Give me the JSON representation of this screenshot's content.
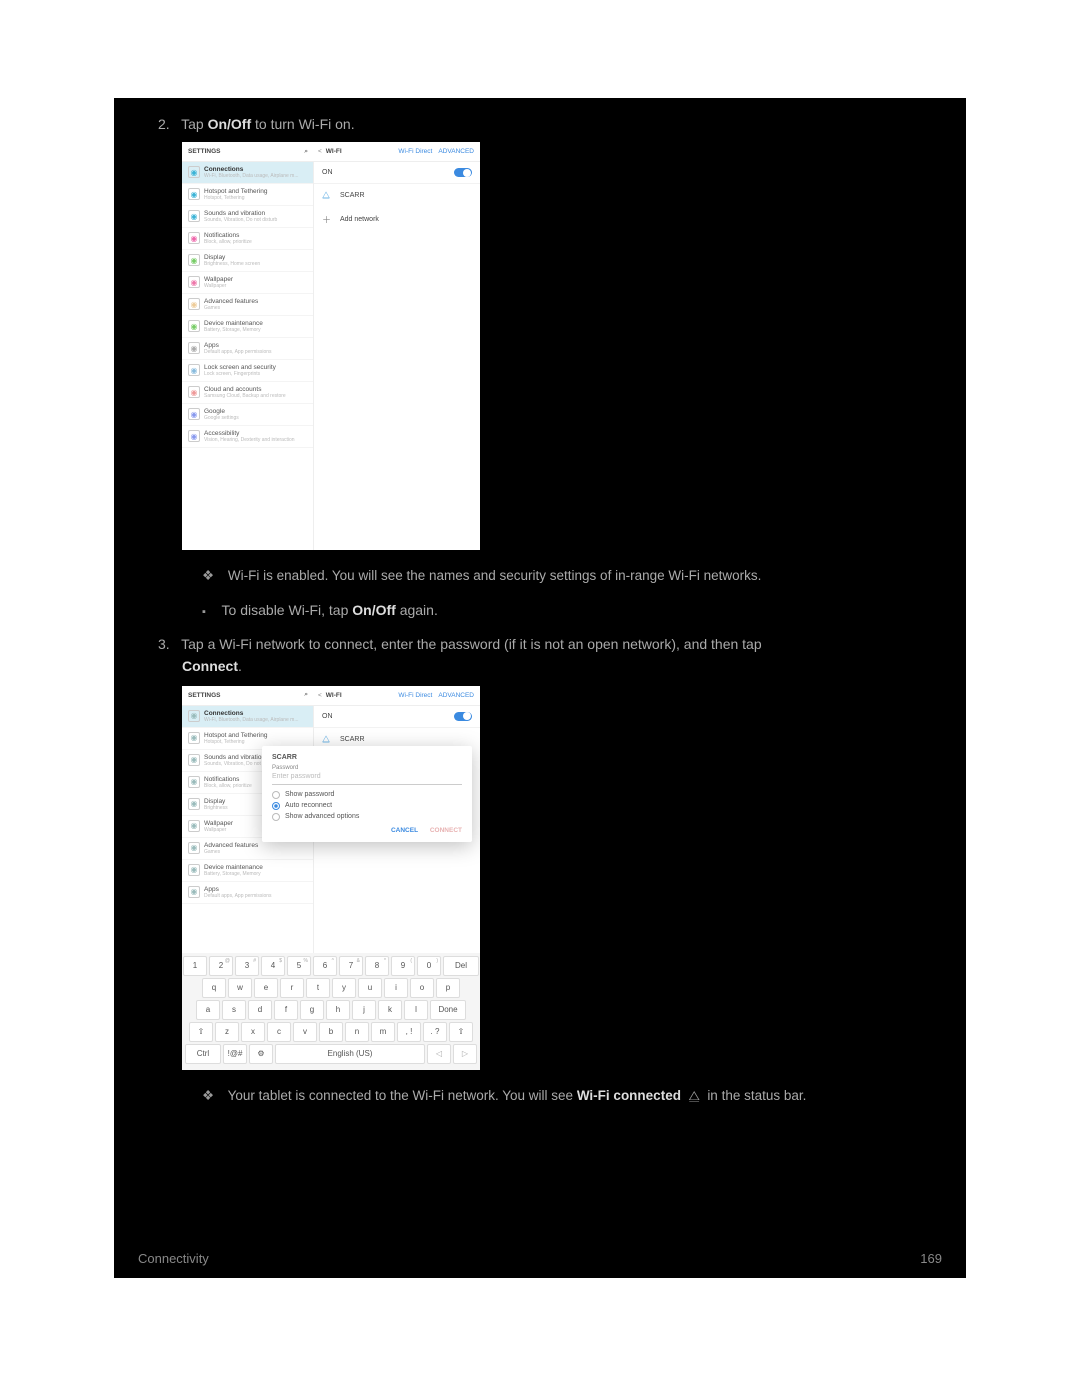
{
  "step2_prefix": "2.",
  "step2_text_a": "Tap ",
  "step2_bold": "On/Off",
  "step2_text_b": " to turn Wi-Fi on.",
  "screenshot1": {
    "header_left": "SETTINGS",
    "header_right_title": "WI-FI",
    "header_link_direct": "Wi-Fi Direct",
    "header_link_advanced": "ADVANCED",
    "on_label": "ON",
    "network_name": "SCARR",
    "add_network": "Add network",
    "items": [
      {
        "title": "Connections",
        "sub": "Wi-Fi, Bluetooth, Data usage, Airplane m...",
        "sel": true,
        "color": "#3bb3d6"
      },
      {
        "title": "Hotspot and Tethering",
        "sub": "Hotspot, Tethering",
        "color": "#3bb3d6"
      },
      {
        "title": "Sounds and vibration",
        "sub": "Sounds, Vibration, Do not disturb",
        "color": "#3bb3d6"
      },
      {
        "title": "Notifications",
        "sub": "Block, allow, prioritize",
        "color": "#e6a"
      },
      {
        "title": "Display",
        "sub": "Brightness, Home screen",
        "color": "#7c6"
      },
      {
        "title": "Wallpaper",
        "sub": "Wallpaper",
        "color": "#e7a"
      },
      {
        "title": "Advanced features",
        "sub": "Games",
        "color": "#ec9"
      },
      {
        "title": "Device maintenance",
        "sub": "Battery, Storage, Memory",
        "color": "#7c6"
      },
      {
        "title": "Apps",
        "sub": "Default apps, App permissions",
        "color": "#aaa"
      },
      {
        "title": "Lock screen and security",
        "sub": "Lock screen, Fingerprints",
        "color": "#8bd"
      },
      {
        "title": "Cloud and accounts",
        "sub": "Samsung Cloud, Backup and restore",
        "color": "#e99"
      },
      {
        "title": "Google",
        "sub": "Google settings",
        "color": "#89e"
      },
      {
        "title": "Accessibility",
        "sub": "Vision, Hearing, Dexterity and interaction",
        "color": "#89e"
      }
    ]
  },
  "bullet1": "Wi-Fi is enabled. You will see the names and security settings of in-range Wi-Fi networks.",
  "bullet2_a": "To disable Wi-Fi, tap ",
  "bullet2_bold": "On/Off",
  "bullet2_b": " again.",
  "step3_prefix": "3.",
  "step3_a": "Tap a Wi-Fi network to connect, enter the password (if it is not an open network), and then tap ",
  "step3_bold": "Connect",
  "step3_b": ".",
  "screenshot2": {
    "header_left": "SETTINGS",
    "header_right_title": "WI-FI",
    "header_link_direct": "Wi-Fi Direct",
    "header_link_advanced": "ADVANCED",
    "on_label": "ON",
    "network_name": "SCARR",
    "dialog": {
      "title": "SCARR",
      "pw_label": "Password",
      "pw_placeholder": "Enter password",
      "opt1": "Show password",
      "opt2": "Auto reconnect",
      "opt3": "Show advanced options",
      "cancel": "CANCEL",
      "connect": "CONNECT"
    },
    "left_items": [
      {
        "title": "Connections",
        "sub": "Wi-Fi, Bluetooth, Data usage, Airplane m...",
        "sel": true
      },
      {
        "title": "Hotspot and Tethering",
        "sub": "Hotspot, Tethering"
      },
      {
        "title": "Sounds and vibration",
        "sub": "Sounds, Vibration, Do not disturb"
      },
      {
        "title": "Notifications",
        "sub": "Block, allow, prioritize"
      },
      {
        "title": "Display",
        "sub": "Brightness"
      },
      {
        "title": "Wallpaper",
        "sub": "Wallpaper"
      },
      {
        "title": "Advanced features",
        "sub": "Games"
      },
      {
        "title": "Device maintenance",
        "sub": "Battery, Storage, Memory"
      },
      {
        "title": "Apps",
        "sub": "Default apps, App permissions"
      }
    ],
    "keyboard": {
      "row1": [
        "1",
        "2",
        "3",
        "4",
        "5",
        "6",
        "7",
        "8",
        "9",
        "0",
        "Del"
      ],
      "row1_sup": [
        "",
        "@",
        "#",
        "$",
        "%",
        "^",
        "&",
        "*",
        "(",
        ")",
        ""
      ],
      "row2": [
        "q",
        "w",
        "e",
        "r",
        "t",
        "y",
        "u",
        "i",
        "o",
        "p"
      ],
      "row3": [
        "a",
        "s",
        "d",
        "f",
        "g",
        "h",
        "j",
        "k",
        "l",
        "Done"
      ],
      "row4": [
        "⇧",
        "z",
        "x",
        "c",
        "v",
        "b",
        "n",
        "m",
        ", !",
        ". ?",
        "⇧"
      ],
      "row5_ctrl": "Ctrl",
      "row5_sym": "!@#",
      "row5_gear": "⚙",
      "row5_space": "English (US)",
      "row5_left": "◁",
      "row5_right": "▷"
    }
  },
  "bullet3_a": "Your tablet is connected to the Wi-Fi network. You will see ",
  "bullet3_bold": "Wi-Fi connected",
  "bullet3_b": " in the status bar.",
  "footer_left": "Connectivity",
  "footer_right": "169"
}
